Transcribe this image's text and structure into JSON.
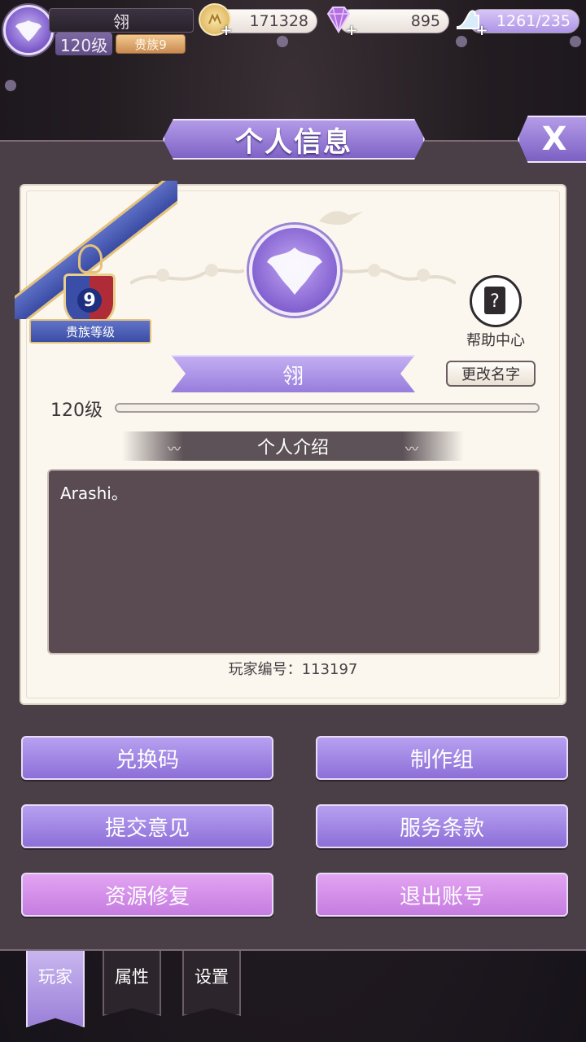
{
  "player": {
    "name": "翎",
    "level_label": "120级",
    "noble_badge": "贵族9",
    "xp_progress": 0.0
  },
  "currencies": {
    "gold": "171328",
    "diamond": "895",
    "stamina": "1261/235"
  },
  "dialog": {
    "title": "个人信息",
    "close": "X"
  },
  "card": {
    "noble_level_number": "9",
    "noble_level_label": "贵族等级",
    "help_label": "帮助中心",
    "name": "翎",
    "rename_label": "更改名字",
    "level_label": "120级",
    "intro_header": "个人介绍",
    "intro_text": "Arashi。",
    "player_id": "玩家编号：113197"
  },
  "buttons": {
    "redeem": "兑换码",
    "credits": "制作组",
    "feedback": "提交意见",
    "terms": "服务条款",
    "repair": "资源修复",
    "logout": "退出账号"
  },
  "tabs": [
    "玩家",
    "属性",
    "设置"
  ],
  "active_tab": "玩家",
  "colors": {
    "accent_purple": "#9b80d8",
    "accent_pink": "#c57ce0",
    "card_bg": "#fbf7ee",
    "panel_bg": "#4a3f46"
  }
}
